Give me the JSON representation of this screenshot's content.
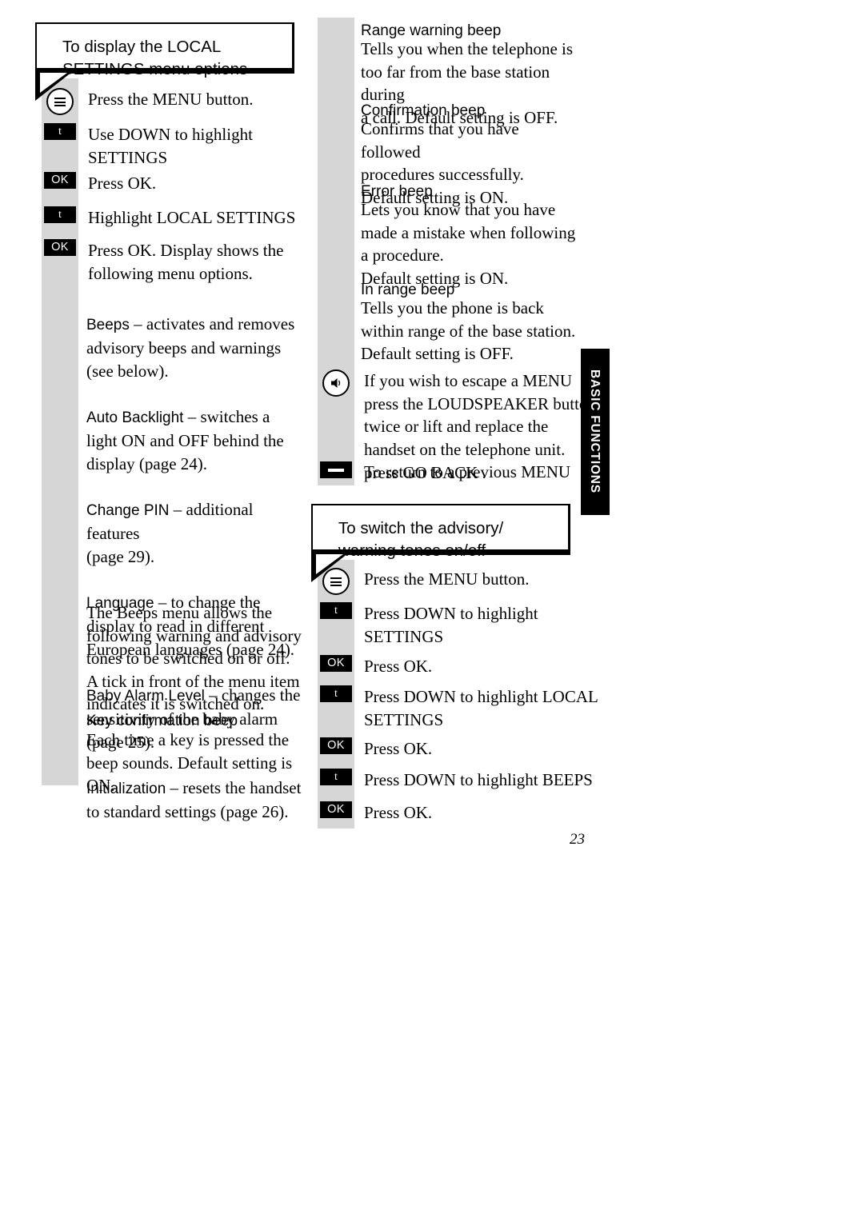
{
  "page": {
    "number": "23",
    "side_tab": "BASIC FUNCTIONS"
  },
  "left_column": {
    "callout": {
      "title": "To display the LOCAL\nSETTINGS menu options"
    },
    "steps": [
      {
        "key": "menu-key",
        "key_label": "",
        "text": "Press the MENU  button."
      },
      {
        "key": "down-key",
        "key_label": "t",
        "text": "Use DOWN to highlight\nSETTINGS"
      },
      {
        "key": "ok-key",
        "key_label": "OK",
        "text": "Press OK."
      },
      {
        "key": "down-key",
        "key_label": "t",
        "text": "Highlight LOCAL SETTINGS"
      },
      {
        "key": "ok-key",
        "key_label": "OK",
        "text": "Press OK. Display shows the\nfollowing menu options."
      }
    ],
    "menu_options": [
      {
        "name": "Beeps",
        "desc": " – activates and removes\nadvisory beeps and warnings\n(see below)."
      },
      {
        "name": "Auto Backlight",
        "desc": "  – switches a\nlight ON and OFF behind the\ndisplay (page 24)."
      },
      {
        "name": "Change PIN",
        "desc": " – additional features\n(page 29)."
      },
      {
        "name": "Language",
        "desc": " – to change the\ndisplay to read in different\nEuropean languages (page 24)."
      },
      {
        "name": "Baby Alarm Level",
        "desc": "  – changes the\nsensitivity of the baby alarm\n(page 25)."
      },
      {
        "name": "Initialization",
        "desc": "  – resets the handset\nto standard settings (page 26)."
      }
    ],
    "beeps_intro": "The Beeps menu allows the\nfollowing warning and advisory\ntones to be switched on or off.\nA tick in front of the menu item\nindicates it is switched on.",
    "beep_entries": [
      {
        "heading": "Key confirmation beep",
        "body": "Each time a key is pressed the\nbeep sounds. Default setting is\nON."
      }
    ]
  },
  "right_column": {
    "beep_entries": [
      {
        "heading": "Range warning beep",
        "body": "Tells you when the telephone is\ntoo far from the base station during\na call. Default setting is OFF."
      },
      {
        "heading": "Confirmation beep",
        "body": "Confirms that you have followed\nprocedures successfully.\nDefault setting is ON."
      },
      {
        "heading": "Error beep",
        "body": "Lets you know that you have\nmade a mistake when following\na procedure.\nDefault setting is ON."
      },
      {
        "heading": "In range beep",
        "body": "Tells you the phone is back\nwithin range of the base station.\nDefault setting is OFF."
      }
    ],
    "escape_note": {
      "text_top": "If you wish to escape a MENU\npress the LOUDSPEAKER  button\ntwice or lift and replace the\nhandset on the telephone unit.\nTo return to a previous MENU",
      "text_bottom": "press GO BACK ."
    },
    "callout": {
      "title": "To switch the advisory/\nwarning tones on/off"
    },
    "steps": [
      {
        "key": "menu-key",
        "key_label": "",
        "text": "Press the MENU  button."
      },
      {
        "key": "down-key",
        "key_label": "t",
        "text": "Press DOWN to highlight\nSETTINGS"
      },
      {
        "key": "ok-key",
        "key_label": "OK",
        "text": "Press OK."
      },
      {
        "key": "down-key",
        "key_label": "t",
        "text": "Press DOWN to highlight LOCAL\nSETTINGS"
      },
      {
        "key": "ok-key",
        "key_label": "OK",
        "text": "Press OK."
      },
      {
        "key": "down-key",
        "key_label": "t",
        "text": "Press DOWN to highlight BEEPS"
      },
      {
        "key": "ok-key",
        "key_label": "OK",
        "text": "Press OK."
      }
    ]
  }
}
